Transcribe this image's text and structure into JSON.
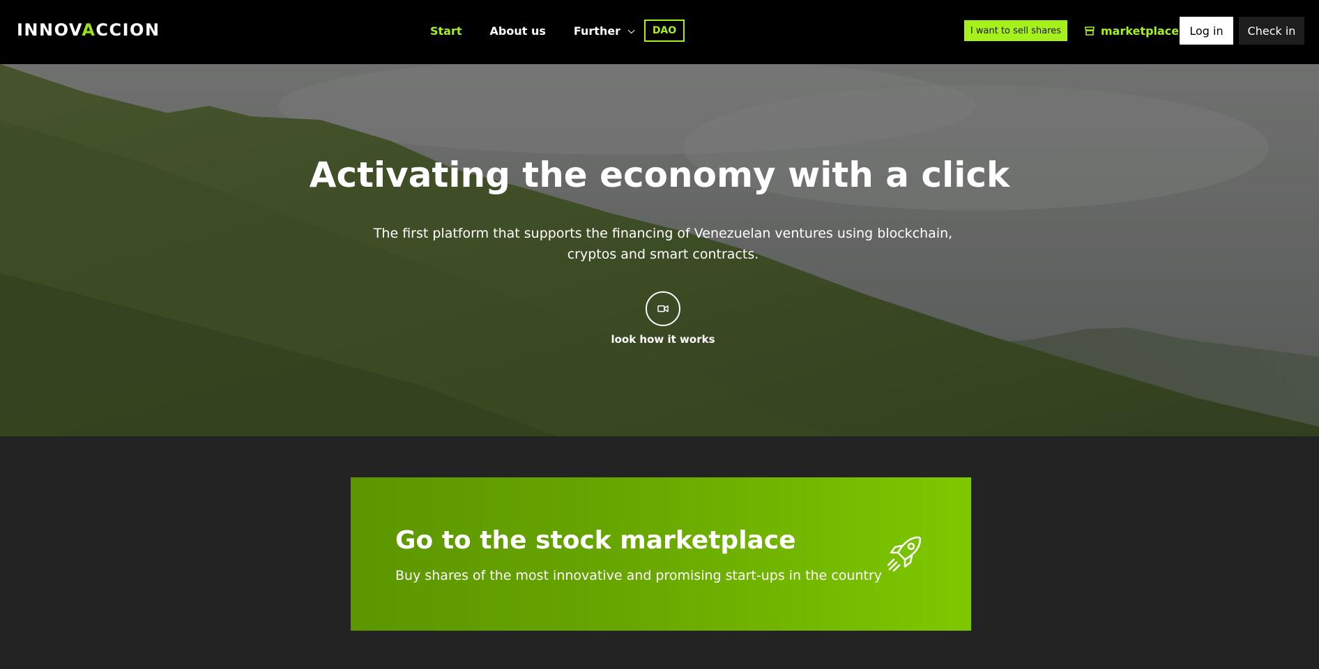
{
  "brand": {
    "logo_prefix": "INNOV",
    "logo_accent": "A",
    "logo_suffix": "CCION"
  },
  "nav": {
    "start": "Start",
    "about": "About us",
    "further": "Further",
    "dao": "DAO"
  },
  "actions": {
    "sell": "I want to sell shares",
    "marketplace": "marketplace",
    "login": "Log in",
    "checkin": "Check in"
  },
  "hero": {
    "title": "Activating the economy with a click",
    "subtitle": "The first platform that supports the financing of Venezuelan ventures using blockchain, cryptos and smart contracts.",
    "video_label": "look how it works"
  },
  "cta": {
    "title": "Go to the stock marketplace",
    "subtitle": "Buy shares of the most innovative and promising start-ups in the country"
  },
  "colors": {
    "accent": "#a6f01c",
    "nav_bg": "#000000",
    "page_bg": "#232323",
    "cta_gradient_start": "#5c9600",
    "cta_gradient_end": "#7ec800"
  },
  "icons": {
    "further_dropdown": "chevron-down-icon",
    "marketplace": "store-icon",
    "video": "video-camera-icon",
    "cta": "rocket-icon"
  }
}
